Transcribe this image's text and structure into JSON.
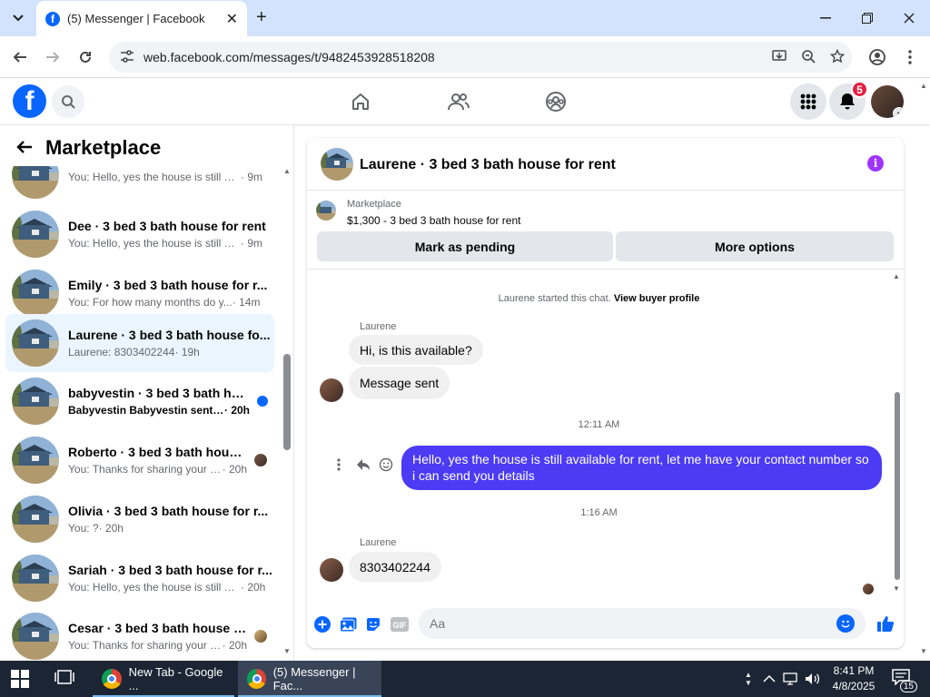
{
  "browser": {
    "tab_title": "(5) Messenger | Facebook",
    "tab_close": "✕",
    "new_tab": "+",
    "url": "web.facebook.com/messages/t/9482453928518208",
    "win_min": "—",
    "win_max": "❐",
    "win_close": "✕"
  },
  "fb": {
    "logo": "f",
    "notifications_count": "5"
  },
  "sidebar": {
    "title": "Marketplace",
    "conversations": [
      {
        "name": "",
        "preview": "You: Hello, yes the house is still av...",
        "time": "· 9m"
      },
      {
        "name": "Dee · 3 bed 3 bath house for rent",
        "preview": "You: Hello, yes the house is still av...",
        "time": "· 9m"
      },
      {
        "name": "Emily · 3 bed 3 bath house for r...",
        "preview": "You: For how many months do y...",
        "time": "· 14m"
      },
      {
        "name": "Laurene · 3 bed 3 bath house fo...",
        "preview": "Laurene: 8303402244",
        "time": "· 19h"
      },
      {
        "name": "babyvestin · 3 bed 3 bath hou...",
        "preview": "Babyvestin Babyvestin sent yo...",
        "time": "· 20h"
      },
      {
        "name": "Roberto · 3 bed 3 bath house ...",
        "preview": "You: Thanks for sharing your n...",
        "time": "· 20h"
      },
      {
        "name": "Olivia · 3 bed 3 bath house for r...",
        "preview": "You: ?",
        "time": "· 20h"
      },
      {
        "name": "Sariah · 3 bed 3 bath house for r...",
        "preview": "You: Hello, yes the house is still av...",
        "time": "· 20h"
      },
      {
        "name": "Cesar · 3 bed 3 bath house fo...",
        "preview": "You: Thanks for sharing your n...",
        "time": "· 20h"
      }
    ]
  },
  "chat": {
    "title": "Laurene · 3 bed 3 bath house for rent",
    "info_icon": "i",
    "marketplace_label": "Marketplace",
    "item": "$1,300 - 3 bed 3 bath house for rent",
    "mark_pending": "Mark as pending",
    "more_options": "More options",
    "started_text": "Laurene started this chat.",
    "view_profile": "View buyer profile",
    "sender_name_1": "Laurene",
    "msg_1": "Hi, is this available?",
    "msg_2": "Message sent",
    "time_1": "12:11 AM",
    "msg_out": "Hello, yes the house is still available for rent, let me have your contact number so i can send you  details",
    "time_2": "1:16 AM",
    "sender_name_2": "Laurene",
    "msg_3": "8303402244",
    "input_placeholder": "Aa",
    "gif_label": "GIF"
  },
  "taskbar": {
    "app_1": "New Tab - Google ...",
    "app_2": "(5) Messenger | Fac...",
    "time": "8:41 PM",
    "date": "4/8/2025",
    "notif_count": "15"
  },
  "colors": {
    "accent": "#0866ff",
    "outgoing_bubble": "#4c3bf5",
    "info_purple": "#a033ff",
    "badge_red": "#e41e3f"
  }
}
